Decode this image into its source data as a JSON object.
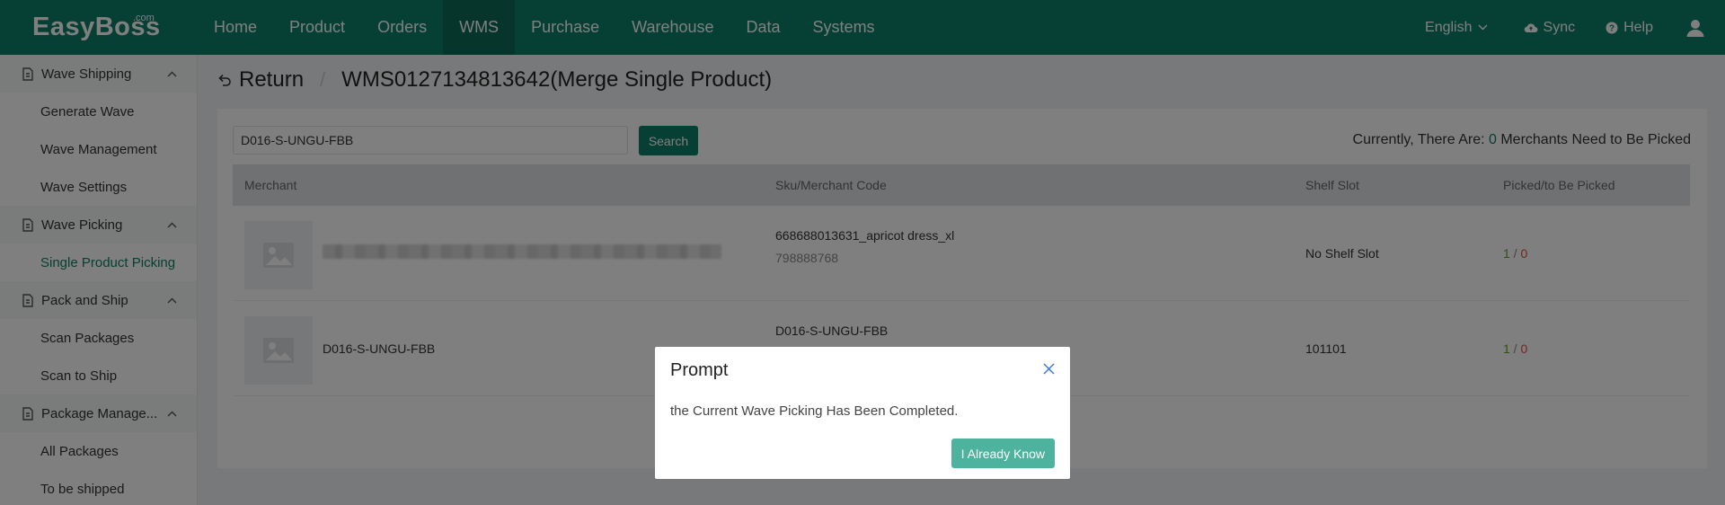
{
  "brand": {
    "name": "EasyBoss",
    "suffix": ".com"
  },
  "nav": {
    "items": [
      {
        "label": "Home"
      },
      {
        "label": "Product"
      },
      {
        "label": "Orders"
      },
      {
        "label": "WMS",
        "active": true
      },
      {
        "label": "Purchase"
      },
      {
        "label": "Warehouse"
      },
      {
        "label": "Data"
      },
      {
        "label": "Systems"
      }
    ],
    "language": "English",
    "sync": "Sync",
    "help": "Help"
  },
  "sidebar": {
    "groups": [
      {
        "label": "Wave Shipping",
        "items": [
          {
            "label": "Generate Wave"
          },
          {
            "label": "Wave Management"
          },
          {
            "label": "Wave Settings"
          }
        ]
      },
      {
        "label": "Wave Picking",
        "items": [
          {
            "label": "Single Product Picking",
            "active": true
          }
        ]
      },
      {
        "label": "Pack and Ship",
        "items": [
          {
            "label": "Scan Packages"
          },
          {
            "label": "Scan to Ship"
          }
        ]
      },
      {
        "label": "Package Manage...",
        "items": [
          {
            "label": "All Packages"
          },
          {
            "label": "To be shipped"
          }
        ]
      }
    ]
  },
  "page": {
    "back_label": "Return",
    "separator": "/",
    "title": "WMS0127134813642(Merge Single Product)"
  },
  "search": {
    "value": "D016-S-UNGU-FBB",
    "button": "Search",
    "summary_prefix": "Currently, There Are: ",
    "summary_count": "0",
    "summary_suffix": " Merchants Need to Be Picked"
  },
  "table": {
    "headers": {
      "merchant": "Merchant",
      "sku": "Sku/Merchant Code",
      "shelf": "Shelf Slot",
      "picked": "Picked/to Be Picked"
    },
    "rows": [
      {
        "merchant_name": "",
        "sku": "668688013631_apricot dress_xl",
        "merchant_code": "798888768",
        "shelf": "No Shelf Slot",
        "picked": "1",
        "slash": " / ",
        "to_pick": "0"
      },
      {
        "merchant_name": "D016-S-UNGU-FBB",
        "sku": "D016-S-UNGU-FBB",
        "merchant_code": "",
        "shelf": "101101",
        "picked": "1",
        "slash": " / ",
        "to_pick": "0"
      }
    ]
  },
  "modal": {
    "title": "Prompt",
    "message": "the Current Wave Picking Has Been Completed.",
    "button": "I Already Know"
  },
  "colors": {
    "primary": "#0d8068",
    "modal_button": "#4db39e",
    "picked": "#67a120",
    "to_pick": "#e84a3c"
  }
}
